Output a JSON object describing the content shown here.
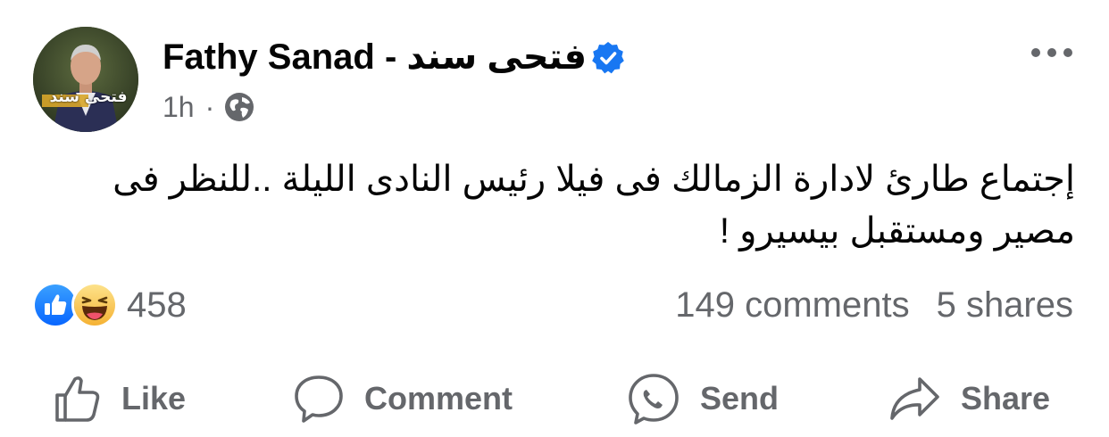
{
  "post": {
    "author": {
      "name": "Fathy Sanad -  فتحى  سند",
      "verified": true,
      "avatar_caption": "فتحى سند"
    },
    "timestamp": "1h",
    "separator": "·",
    "audience_icon": "globe-icon",
    "more_icon": "more-horizontal-icon",
    "text": "إجتماع طارئ لادارة الزمالك فى فيلا رئيس النادى الليلة ..للنظر فى مصير ومستقبل بيسيرو !",
    "reactions": {
      "icons": [
        "like-reaction-icon",
        "haha-reaction-icon"
      ],
      "count": "458"
    },
    "comments": "149 comments",
    "shares": "5 shares"
  },
  "actions": [
    {
      "label": "Like",
      "icon": "thumbs-up-icon"
    },
    {
      "label": "Comment",
      "icon": "comment-bubble-icon"
    },
    {
      "label": "Send",
      "icon": "messenger-send-icon"
    },
    {
      "label": "Share",
      "icon": "share-arrow-icon"
    }
  ],
  "colors": {
    "text_primary": "#050505",
    "text_secondary": "#65676b",
    "verified_blue": "#1877f2",
    "like_blue": "#1877f2",
    "haha_yellow": "#f7c13b"
  }
}
